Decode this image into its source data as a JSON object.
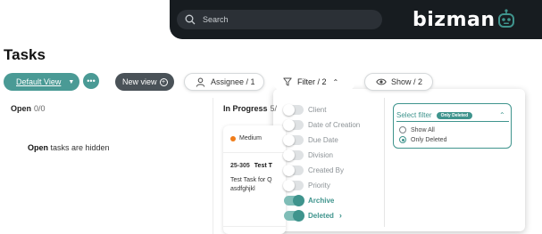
{
  "header": {
    "search_placeholder": "Search",
    "logo": "bizman"
  },
  "page": {
    "title": "Tasks"
  },
  "toolbar": {
    "default_view": "Default View",
    "more": "•••",
    "new_view": "New view",
    "assignee": "Assignee / 1",
    "filter": "Filter / 2",
    "show": "Show / 2"
  },
  "columns": {
    "open": {
      "title": "Open",
      "count": "0/0",
      "hidden_bold": "Open",
      "hidden_rest": " tasks are hidden"
    },
    "in_progress": {
      "title": "In Progress",
      "count": "5/"
    }
  },
  "card": {
    "priority": "Medium",
    "code": "25-305",
    "name": "Test T",
    "desc_line1": "Test Task for Q",
    "desc_line2": "asdfghjkl"
  },
  "filter_panel": {
    "items": [
      {
        "label": "Client",
        "on": false
      },
      {
        "label": "Date of Creation",
        "on": false
      },
      {
        "label": "Due Date",
        "on": false
      },
      {
        "label": "Division",
        "on": false
      },
      {
        "label": "Created By",
        "on": false
      },
      {
        "label": "Priority",
        "on": false
      },
      {
        "label": "Archive",
        "on": true
      },
      {
        "label": "Deleted",
        "on": true
      }
    ],
    "select": {
      "label": "Select filter",
      "badge": "Only Deleted",
      "options": [
        {
          "label": "Show All",
          "selected": false
        },
        {
          "label": "Only Deleted",
          "selected": true
        }
      ]
    }
  },
  "colors": {
    "accent": "#3f948d",
    "header_bg": "#171c20",
    "priority_medium": "#f07d1a"
  }
}
